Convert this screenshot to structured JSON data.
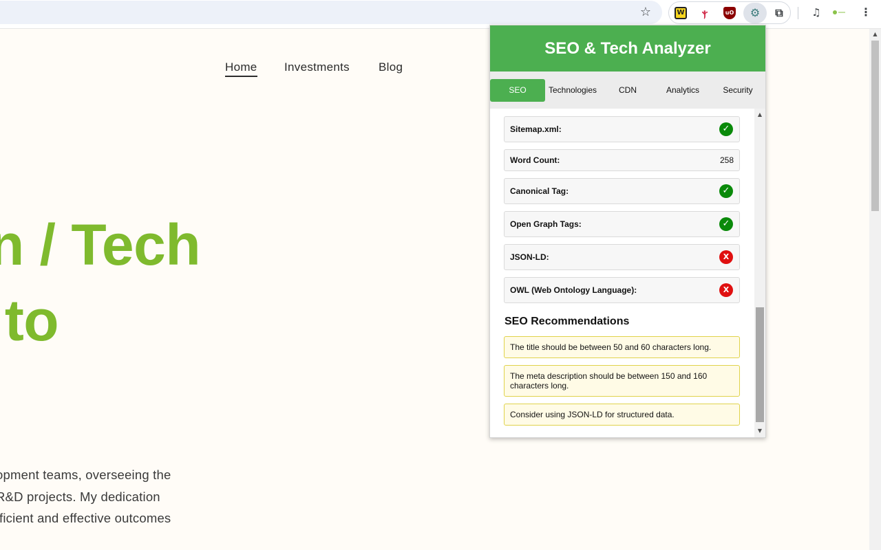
{
  "browser": {
    "icons": {
      "bookmark": "star-icon",
      "extensions": [
        "wappalyzer-icon",
        "bird-extension-icon",
        "ublock-icon",
        "seo-analyzer-icon",
        "extensions-puzzle-icon"
      ],
      "media": "media-controls-icon",
      "profile": "profile-icon",
      "menu": "more-menu-icon"
    },
    "glyphs": {
      "star": "☆",
      "w": "W",
      "bird": "ⲯ",
      "ub": "uO",
      "gear": "⚙",
      "puzzle": "⧉",
      "media": "♫",
      "menu": "⋮",
      "up_arrow": "▲",
      "down_arrow": "▼"
    }
  },
  "site": {
    "nav": {
      "home": "Home",
      "investments": "Investments",
      "blog": "Blog"
    },
    "hero": {
      "line1": "n / Tech",
      "line2": " to"
    },
    "body": {
      "line1": "opment teams, overseeing the",
      "line2": "R&D projects. My dedication",
      "line3": "fficient and effective outcomes"
    },
    "accent_color": "#7fba2e"
  },
  "popup": {
    "title": "SEO & Tech Analyzer",
    "header_color": "#4caf50",
    "tabs": [
      {
        "label": "SEO",
        "active": true
      },
      {
        "label": "Technologies",
        "active": false
      },
      {
        "label": "CDN",
        "active": false
      },
      {
        "label": "Analytics",
        "active": false
      },
      {
        "label": "Security",
        "active": false
      }
    ],
    "checks": [
      {
        "label": "Sitemap.xml:",
        "status": "pass",
        "glyph": "✓"
      },
      {
        "label": "Word Count:",
        "value": "258"
      },
      {
        "label": "Canonical Tag:",
        "status": "pass",
        "glyph": "✓"
      },
      {
        "label": "Open Graph Tags:",
        "status": "pass",
        "glyph": "✓"
      },
      {
        "label": "JSON-LD:",
        "status": "fail",
        "glyph": "X"
      },
      {
        "label": "OWL (Web Ontology Language):",
        "status": "fail",
        "glyph": "X"
      }
    ],
    "recommendations_heading": "SEO Recommendations",
    "recommendations": [
      "The title should be between 50 and 60 characters long.",
      "The meta description should be between 150 and 160 characters long.",
      "Consider using JSON-LD for structured data."
    ],
    "status_colors": {
      "pass": "#0a8a0a",
      "fail": "#e01010"
    }
  }
}
